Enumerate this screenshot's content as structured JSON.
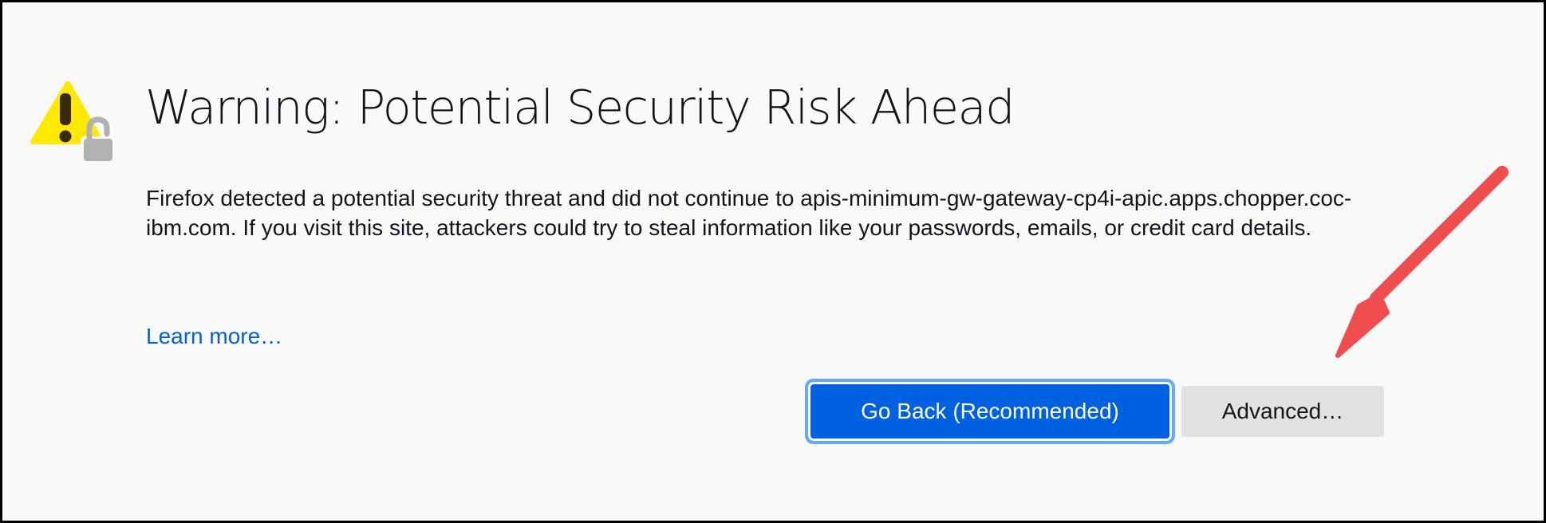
{
  "page": {
    "title": "Warning: Potential Security Risk Ahead",
    "description": "Firefox detected a potential security threat and did not continue to apis-minimum-gw-gateway-cp4i-apic.apps.chopper.coc-ibm.com. If you visit this site, attackers could try to steal information like your passwords, emails, or credit card details.",
    "learn_more_label": "Learn more…"
  },
  "buttons": {
    "go_back_label": "Go Back (Recommended)",
    "advanced_label": "Advanced…"
  },
  "icons": {
    "warning": "warning-triangle-with-lock-icon",
    "annotation": "red-arrow-pointing-to-advanced"
  },
  "colors": {
    "page_background": "#f9f9fa",
    "text": "#15141a",
    "link": "#0061e0",
    "primary_button": "#0061e0",
    "primary_button_focus_ring": "#64a9ff",
    "secondary_button": "#e2e2e5",
    "warning_yellow": "#ffe900",
    "lock_gray": "#b1b1b3",
    "annotation_arrow": "#f04e4e"
  }
}
